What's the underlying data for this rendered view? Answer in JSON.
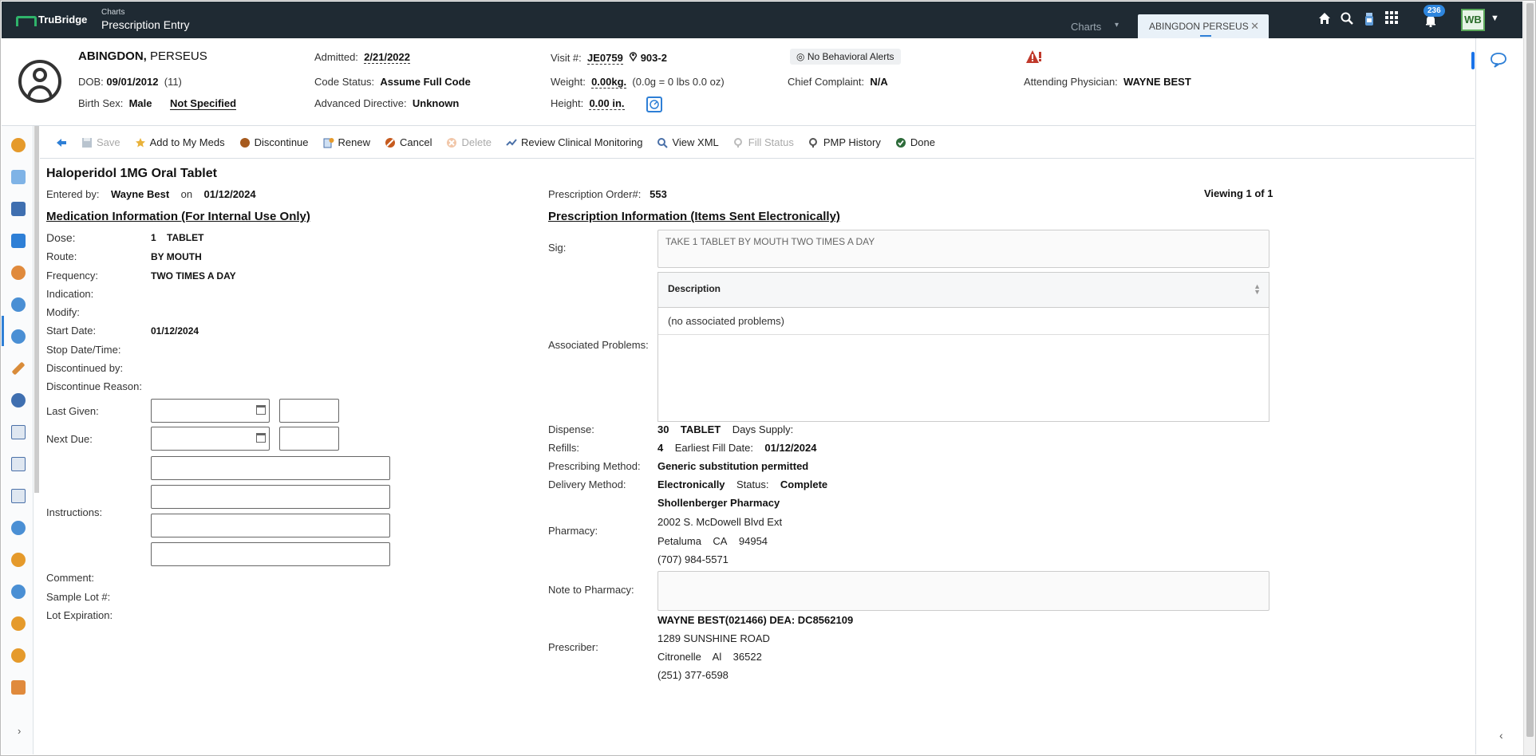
{
  "app": {
    "brand": "TruBridge",
    "breadcrumb": "Charts",
    "title": "Prescription Entry",
    "tabs": [
      {
        "label": "Charts"
      },
      {
        "label": "ABINGDON PERSEUS"
      }
    ],
    "notifications_count": "236",
    "user_initials": "WB"
  },
  "patient": {
    "last_name": "ABINGDON,",
    "first_name": "PERSEUS",
    "dob_label": "DOB:",
    "dob": "09/01/2012",
    "age": "(11)",
    "birth_sex_label": "Birth Sex:",
    "birth_sex": "Male",
    "gender_identity": "Not Specified",
    "admitted_label": "Admitted:",
    "admitted": "2/21/2022",
    "code_status_label": "Code Status:",
    "code_status": "Assume Full Code",
    "advanced_directive_label": "Advanced Directive:",
    "advanced_directive": "Unknown",
    "visit_label": "Visit #:",
    "visit": "JE0759",
    "room": "903-2",
    "weight_label": "Weight:",
    "weight": "0.00kg.",
    "weight_note": "(0.0g = 0 lbs 0.0 oz)",
    "height_label": "Height:",
    "height": "0.00 in.",
    "behavioral_alerts": "No Behavioral Alerts",
    "chief_complaint_label": "Chief Complaint:",
    "chief_complaint": "N/A",
    "attending_label": "Attending Physician:",
    "attending": "WAYNE BEST"
  },
  "toolbar": {
    "save": "Save",
    "add_to_my_meds": "Add to My Meds",
    "discontinue": "Discontinue",
    "renew": "Renew",
    "cancel": "Cancel",
    "delete": "Delete",
    "review_clinical_monitoring": "Review Clinical Monitoring",
    "view_xml": "View XML",
    "fill_status": "Fill Status",
    "pmp_history": "PMP History",
    "done": "Done"
  },
  "rx": {
    "title": "Haloperidol 1MG Oral Tablet",
    "entered_by_label": "Entered by:",
    "entered_by": "Wayne Best",
    "on_label": "on",
    "entered_date": "01/12/2024",
    "order_label": "Prescription Order#:",
    "order_number": "553",
    "viewing": "Viewing 1 of 1"
  },
  "med_info": {
    "heading": "Medication Information (For Internal Use Only)",
    "dose_label": "Dose:",
    "dose_qty": "1",
    "dose_unit": "TABLET",
    "route_label": "Route:",
    "route": "BY MOUTH",
    "frequency_label": "Frequency:",
    "frequency": "TWO TIMES A DAY",
    "indication_label": "Indication:",
    "modify_label": "Modify:",
    "start_date_label": "Start Date:",
    "start_date": "01/12/2024",
    "stop_label": "Stop Date/Time:",
    "discontinued_by_label": "Discontinued by:",
    "discontinue_reason_label": "Discontinue Reason:",
    "last_given_label": "Last Given:",
    "next_due_label": "Next Due:",
    "instructions_label": "Instructions:",
    "comment_label": "Comment:",
    "sample_lot_label": "Sample Lot #:",
    "lot_expiration_label": "Lot Expiration:"
  },
  "rx_info": {
    "heading": "Prescription Information (Items Sent Electronically)",
    "sig_label": "Sig:",
    "sig": "TAKE 1 TABLET BY MOUTH TWO TIMES A DAY",
    "problems_label": "Associated Problems:",
    "problems_col": "Description",
    "problems_empty": "(no associated problems)",
    "dispense_label": "Dispense:",
    "dispense_qty": "30",
    "dispense_unit": "TABLET",
    "days_supply_label": "Days Supply:",
    "refills_label": "Refills:",
    "refills": "4",
    "earliest_fill_label": "Earliest Fill Date:",
    "earliest_fill": "01/12/2024",
    "prescribing_method_label": "Prescribing Method:",
    "prescribing_method": "Generic substitution permitted",
    "delivery_method_label": "Delivery Method:",
    "delivery_method": "Electronically",
    "status_label": "Status:",
    "status": "Complete",
    "pharmacy_label": "Pharmacy:",
    "pharmacy_name": "Shollenberger Pharmacy",
    "pharmacy_address": "2002 S. McDowell Blvd Ext",
    "pharmacy_city": "Petaluma",
    "pharmacy_state": "CA",
    "pharmacy_zip": "94954",
    "pharmacy_phone": "(707) 984-5571",
    "note_label": "Note to Pharmacy:",
    "prescriber_label": "Prescriber:",
    "prescriber_name": "WAYNE BEST(021466) DEA: DC8562109",
    "prescriber_address": "1289 SUNSHINE ROAD",
    "prescriber_city": "Citronelle",
    "prescriber_state": "Al",
    "prescriber_zip": "36522",
    "prescriber_phone": "(251) 377-6598"
  },
  "colors": {
    "topbar": "#1f2a33",
    "accent": "#2e7fd6",
    "brand_green": "#2fb36a"
  }
}
